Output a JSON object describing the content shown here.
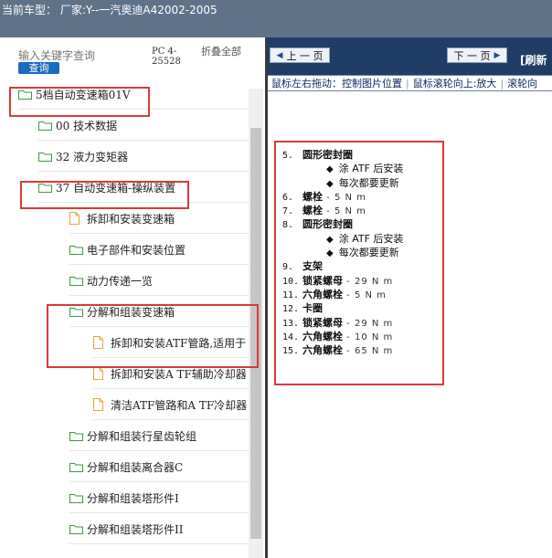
{
  "header": {
    "title": "当前车型：  厂家:Y--一汽奥迪A42002-2005"
  },
  "search": {
    "placeholder": "输入关键字查询",
    "button_label": "查询"
  },
  "pc_code": "PC 4-25528",
  "collapse_all": "折叠全部",
  "tree": [
    {
      "label": "5档自动变速箱01V",
      "icon": "folder"
    },
    {
      "label": "00 技术数据",
      "icon": "folder"
    },
    {
      "label": "32 液力变矩器",
      "icon": "folder"
    },
    {
      "label": "37 自动变速箱-操纵装置",
      "icon": "folder"
    },
    {
      "label": "拆卸和安装变速箱",
      "icon": "document"
    },
    {
      "label": "电子部件和安装位置",
      "icon": "folder"
    },
    {
      "label": "动力传递一览",
      "icon": "folder"
    },
    {
      "label": "分解和组装变速箱",
      "icon": "folder"
    },
    {
      "label": "拆卸和安装ATF管路,适用于",
      "icon": "document"
    },
    {
      "label": "拆卸和安装A TF辅助冷却器",
      "icon": "document"
    },
    {
      "label": "清洁ATF管路和A TF冷却器",
      "icon": "document"
    },
    {
      "label": "分解和组装行星齿轮组",
      "icon": "folder"
    },
    {
      "label": "分解和组装离合器C",
      "icon": "folder"
    },
    {
      "label": "分解和组装塔形件I",
      "icon": "folder"
    },
    {
      "label": "分解和组装塔形件II",
      "icon": "folder"
    }
  ],
  "toolbar": {
    "prev_label": "上 一 页",
    "next_label": "下 一 页",
    "refresh_label": "[刷新"
  },
  "hints": [
    "鼠标左右拖动：控制图片位置",
    "鼠标滚轮向上:放大",
    "滚轮向"
  ],
  "legend": [
    {
      "num": "5.",
      "name": "圆形密封圈",
      "spec": "",
      "notes": [
        "涂 ATF 后安装",
        "每次都要更新"
      ]
    },
    {
      "num": "6.",
      "name": "螺栓",
      "spec": " - 5 N m",
      "notes": []
    },
    {
      "num": "7.",
      "name": "螺栓",
      "spec": " - 5 N m",
      "notes": []
    },
    {
      "num": "8.",
      "name": "圆形密封圈",
      "spec": "",
      "notes": [
        "涂 ATF 后安装",
        "每次都要更新"
      ]
    },
    {
      "num": "9.",
      "name": "支架",
      "spec": "",
      "notes": []
    },
    {
      "num": "10.",
      "name": "锁紧螺母",
      "spec": " - 29 N m",
      "notes": []
    },
    {
      "num": "11.",
      "name": "六角螺栓",
      "spec": " - 5 N m",
      "notes": []
    },
    {
      "num": "12.",
      "name": "卡圈",
      "spec": "",
      "notes": []
    },
    {
      "num": "13.",
      "name": "锁紧螺母",
      "spec": " - 29 N m",
      "notes": []
    },
    {
      "num": "14.",
      "name": "六角螺栓",
      "spec": " - 10 N m",
      "notes": []
    },
    {
      "num": "15.",
      "name": "六角螺栓",
      "spec": " - 65 N m",
      "notes": []
    }
  ],
  "colors": {
    "header_bg": "#5f7388",
    "toolbar_bg": "#1f3d66",
    "highlight": "#d93a3a",
    "button_blue": "#1a6bc2"
  }
}
